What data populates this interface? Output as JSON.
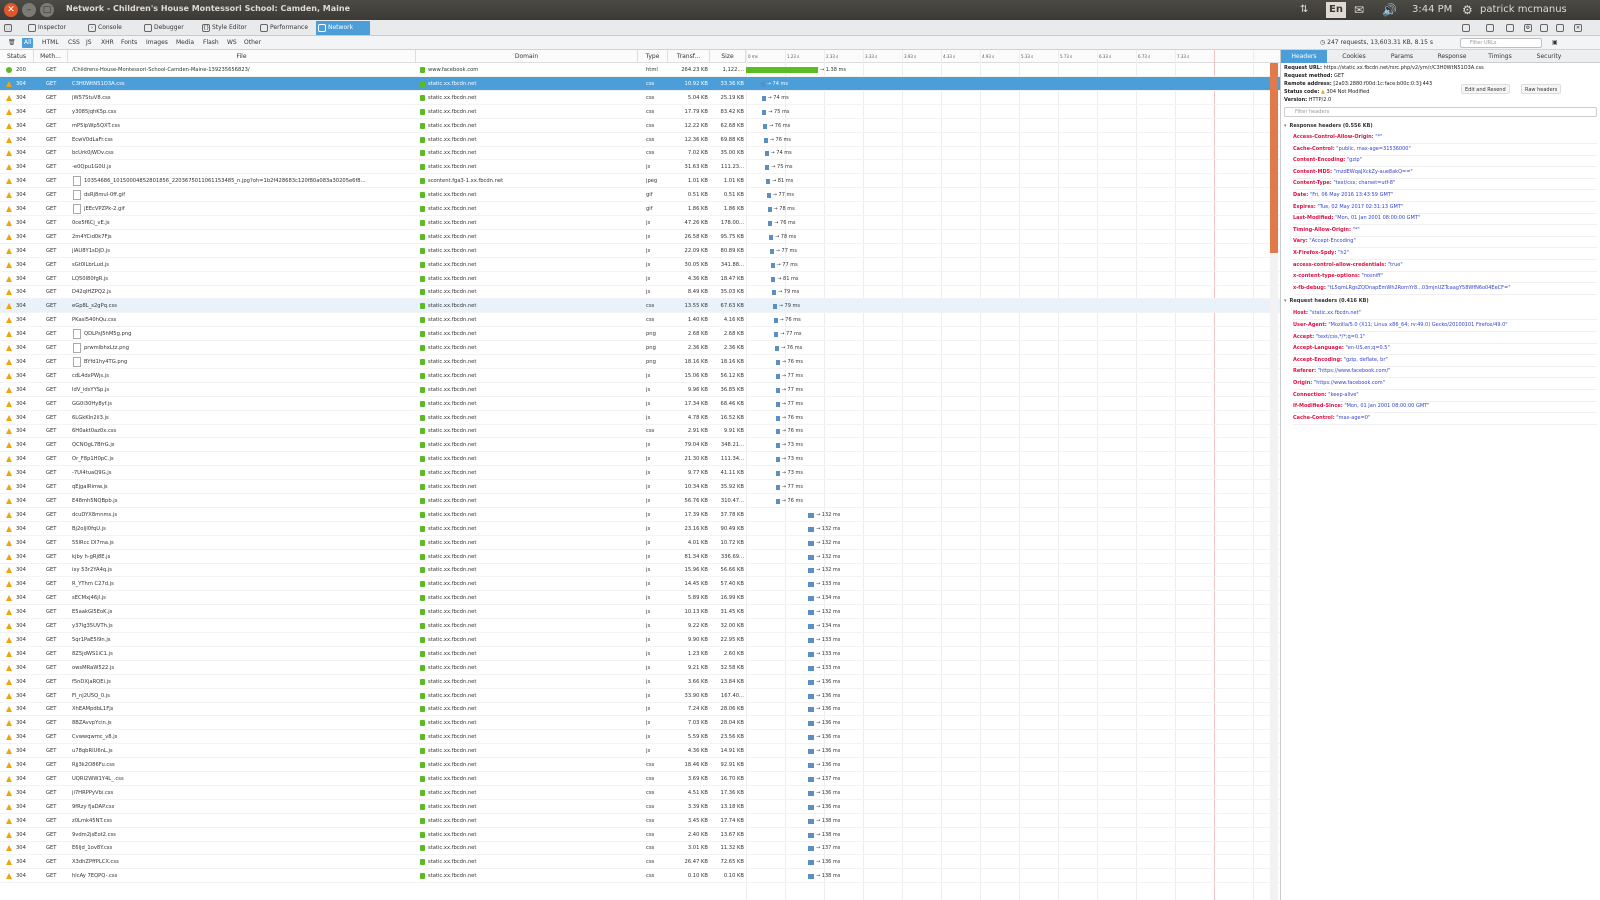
{
  "window": {
    "title": "Network - Children's House Montessori School: Camden, Maine"
  },
  "tray": {
    "lang": "En",
    "time": "3:44 PM",
    "user": "patrick mcmanus"
  },
  "toolbar": {
    "tools": [
      "Inspector",
      "Console",
      "Debugger",
      "Style Editor",
      "Performance",
      "Network"
    ],
    "active": "Network"
  },
  "filters": {
    "types": [
      "All",
      "HTML",
      "CSS",
      "JS",
      "XHR",
      "Fonts",
      "Images",
      "Media",
      "Flash",
      "WS",
      "Other"
    ],
    "active": "All"
  },
  "summary": "247 requests, 13,603.31 KB, 8.15 s",
  "filter_url_placeholder": "Filter URLs",
  "columns": {
    "status": "Status",
    "method": "Meth...",
    "file": "File",
    "domain": "Domain",
    "type": "Type",
    "transferred": "Transf...",
    "size": "Size"
  },
  "timeline_ticks": [
    "0 ms",
    "1.23 s",
    "2.33 s",
    "3.33 s",
    "3.93 s",
    "4.33 s",
    "4.93 s",
    "5.33 s",
    "5.73 s",
    "6.33 s",
    "6.73 s",
    "7.33 s"
  ],
  "requests": [
    {
      "status": "200",
      "method": "GET",
      "file": "/Childrens-House-Montessori-School-Camden-Maine-139235656823/",
      "domain": "www.facebook.com",
      "type": "html",
      "transferred": "264.23 KB",
      "size": "1,122....",
      "timing": "→ 1.38 ms"
    },
    {
      "status": "304",
      "method": "GET",
      "file": "C3H0WtN51O3A.css",
      "domain": "static.xx.fbcdn.net",
      "type": "css",
      "transferred": "10.92 KB",
      "size": "33.36 KB",
      "timing": "→ 74 ms"
    },
    {
      "status": "304",
      "method": "GET",
      "file": "jW57StuV8.css",
      "domain": "static.xx.fbcdn.net",
      "type": "css",
      "transferred": "5.04 KB",
      "size": "25.19 KB",
      "timing": "→ 74 ms"
    },
    {
      "status": "304",
      "method": "GET",
      "file": "y3085jqhK5p.css",
      "domain": "static.xx.fbcdn.net",
      "type": "css",
      "transferred": "17.79 KB",
      "size": "83.42 KB",
      "timing": "→ 75 ms"
    },
    {
      "status": "304",
      "method": "GET",
      "file": "mP5lpWp5QXT.css",
      "domain": "static.xx.fbcdn.net",
      "type": "css",
      "transferred": "12.22 KB",
      "size": "62.68 KB",
      "timing": "→ 76 ms"
    },
    {
      "status": "304",
      "method": "GET",
      "file": "EcwV0dLaFr.css",
      "domain": "static.xx.fbcdn.net",
      "type": "css",
      "transferred": "12.36 KB",
      "size": "69.88 KB",
      "timing": "→ 76 ms"
    },
    {
      "status": "304",
      "method": "GET",
      "file": "bcUrk0jWDv.css",
      "domain": "static.xx.fbcdn.net",
      "type": "css",
      "transferred": "7.02 KB",
      "size": "35.00 KB",
      "timing": "→ 74 ms"
    },
    {
      "status": "304",
      "method": "GET",
      "file": "-e0Qpu1G0U.js",
      "domain": "static.xx.fbcdn.net",
      "type": "js",
      "transferred": "31.63 KB",
      "size": "111.23...",
      "timing": "→ 75 ms"
    },
    {
      "status": "304",
      "method": "GET",
      "file": "10354686_10150004852801856_2203675011061153485_n.jpg?oh=1b2f428683c120f80a083a30205e6f8...",
      "domain": "scontent.fga3-1.xx.fbcdn.net",
      "type": "jpeg",
      "transferred": "1.01 KB",
      "size": "1.01 KB",
      "timing": "→ 81 ms"
    },
    {
      "status": "304",
      "method": "GET",
      "file": "dsRj8mul-0ff.gif",
      "domain": "static.xx.fbcdn.net",
      "type": "gif",
      "transferred": "0.51 KB",
      "size": "0.51 KB",
      "timing": "→ 77 ms"
    },
    {
      "status": "304",
      "method": "GET",
      "file": "jEEcVPZPk-2.gif",
      "domain": "static.xx.fbcdn.net",
      "type": "gif",
      "transferred": "1.86 KB",
      "size": "1.86 KB",
      "timing": "→ 78 ms"
    },
    {
      "status": "304",
      "method": "GET",
      "file": "0ce5f6Cj_vE.js",
      "domain": "static.xx.fbcdn.net",
      "type": "js",
      "transferred": "47.26 KB",
      "size": "178.00...",
      "timing": "→ 76 ms"
    },
    {
      "status": "304",
      "method": "GET",
      "file": "2m4YCid0k7Fjs",
      "domain": "static.xx.fbcdn.net",
      "type": "js",
      "transferred": "26.58 KB",
      "size": "95.75 KB",
      "timing": "→ 78 ms"
    },
    {
      "status": "304",
      "method": "GET",
      "file": "jlAU8Y1sDjD.js",
      "domain": "static.xx.fbcdn.net",
      "type": "js",
      "transferred": "22.09 KB",
      "size": "80.89 KB",
      "timing": "→ 77 ms"
    },
    {
      "status": "304",
      "method": "GET",
      "file": "sGt0lLbrLud.js",
      "domain": "static.xx.fbcdn.net",
      "type": "js",
      "transferred": "30.05 KB",
      "size": "341.88...",
      "timing": "→ 77 ms"
    },
    {
      "status": "304",
      "method": "GET",
      "file": "LQ50l80fgR.js",
      "domain": "static.xx.fbcdn.net",
      "type": "js",
      "transferred": "4.36 KB",
      "size": "18.47 KB",
      "timing": "→ 81 ms"
    },
    {
      "status": "304",
      "method": "GET",
      "file": "D42qlHZPQ2.js",
      "domain": "static.xx.fbcdn.net",
      "type": "js",
      "transferred": "8.49 KB",
      "size": "35.03 KB",
      "timing": "→ 79 ms"
    },
    {
      "status": "304",
      "method": "GET",
      "file": "eGp8L_s2gPq.css",
      "domain": "static.xx.fbcdn.net",
      "type": "css",
      "transferred": "13.55 KB",
      "size": "67.63 KB",
      "timing": "→ 79 ms"
    },
    {
      "status": "304",
      "method": "GET",
      "file": "PKasl540hQu.css",
      "domain": "static.xx.fbcdn.net",
      "type": "css",
      "transferred": "1.40 KB",
      "size": "4.16 KB",
      "timing": "→ 76 ms"
    },
    {
      "status": "304",
      "method": "GET",
      "file": "QDLPsJ5hM5g.png",
      "domain": "static.xx.fbcdn.net",
      "type": "png",
      "transferred": "2.68 KB",
      "size": "2.68 KB",
      "timing": "→ 77 ms"
    },
    {
      "status": "304",
      "method": "GET",
      "file": "prwmlbhxLtz.png",
      "domain": "static.xx.fbcdn.net",
      "type": "png",
      "transferred": "2.36 KB",
      "size": "2.36 KB",
      "timing": "→ 76 ms"
    },
    {
      "status": "304",
      "method": "GET",
      "file": "BYfd1hy4TG.png",
      "domain": "static.xx.fbcdn.net",
      "type": "png",
      "transferred": "18.16 KB",
      "size": "18.16 KB",
      "timing": "→ 76 ms"
    },
    {
      "status": "304",
      "method": "GET",
      "file": "cdL4dxPWjs.js",
      "domain": "static.xx.fbcdn.net",
      "type": "js",
      "transferred": "15.06 KB",
      "size": "56.12 KB",
      "timing": "→ 77 ms"
    },
    {
      "status": "304",
      "method": "GET",
      "file": "IdV_idsYYSp.js",
      "domain": "static.xx.fbcdn.net",
      "type": "js",
      "transferred": "9.96 KB",
      "size": "36.85 KB",
      "timing": "→ 77 ms"
    },
    {
      "status": "304",
      "method": "GET",
      "file": "GG0i30Hy8yf.js",
      "domain": "static.xx.fbcdn.net",
      "type": "js",
      "transferred": "17.34 KB",
      "size": "68.46 KB",
      "timing": "→ 77 ms"
    },
    {
      "status": "304",
      "method": "GET",
      "file": "6LGkKIn2il3.js",
      "domain": "static.xx.fbcdn.net",
      "type": "js",
      "transferred": "4.78 KB",
      "size": "16.52 KB",
      "timing": "→ 76 ms"
    },
    {
      "status": "304",
      "method": "GET",
      "file": "6H0akt0az0x.css",
      "domain": "static.xx.fbcdn.net",
      "type": "css",
      "transferred": "2.91 KB",
      "size": "9.91 KB",
      "timing": "→ 76 ms"
    },
    {
      "status": "304",
      "method": "GET",
      "file": "QCNOgL7BfrG.js",
      "domain": "static.xx.fbcdn.net",
      "type": "js",
      "transferred": "79.04 KB",
      "size": "348.21...",
      "timing": "→ 73 ms"
    },
    {
      "status": "304",
      "method": "GET",
      "file": "Or_F8p1H0pC.js",
      "domain": "static.xx.fbcdn.net",
      "type": "js",
      "transferred": "21.30 KB",
      "size": "111.34...",
      "timing": "→ 73 ms"
    },
    {
      "status": "304",
      "method": "GET",
      "file": "-7Ul4tuaQ9G.js",
      "domain": "static.xx.fbcdn.net",
      "type": "js",
      "transferred": "9.77 KB",
      "size": "41.11 KB",
      "timing": "→ 73 ms"
    },
    {
      "status": "304",
      "method": "GET",
      "file": "qEjgalRimw.js",
      "domain": "static.xx.fbcdn.net",
      "type": "js",
      "transferred": "10.34 KB",
      "size": "35.92 KB",
      "timing": "→ 77 ms"
    },
    {
      "status": "304",
      "method": "GET",
      "file": "E48mh5NQBpb.js",
      "domain": "static.xx.fbcdn.net",
      "type": "js",
      "transferred": "56.76 KB",
      "size": "310.47...",
      "timing": "→ 76 ms"
    },
    {
      "status": "304",
      "method": "GET",
      "file": "dcuDYX8mnms.js",
      "domain": "static.xx.fbcdn.net",
      "type": "js",
      "transferred": "17.39 KB",
      "size": "37.78 KB",
      "timing": "→ 132 ms"
    },
    {
      "status": "304",
      "method": "GET",
      "file": "Bj2oljl0fqU.js",
      "domain": "static.xx.fbcdn.net",
      "type": "js",
      "transferred": "23.16 KB",
      "size": "90.49 KB",
      "timing": "→ 132 ms"
    },
    {
      "status": "304",
      "method": "GET",
      "file": "55lRcc Dl7ma.js",
      "domain": "static.xx.fbcdn.net",
      "type": "js",
      "transferred": "4.01 KB",
      "size": "10.72 KB",
      "timing": "→ 132 ms"
    },
    {
      "status": "304",
      "method": "GET",
      "file": "kjby h-gRj8E.js",
      "domain": "static.xx.fbcdn.net",
      "type": "js",
      "transferred": "81.34 KB",
      "size": "336.69...",
      "timing": "→ 132 ms"
    },
    {
      "status": "304",
      "method": "GET",
      "file": "ixy 53r2YA4q.js",
      "domain": "static.xx.fbcdn.net",
      "type": "js",
      "transferred": "15.96 KB",
      "size": "56.66 KB",
      "timing": "→ 132 ms"
    },
    {
      "status": "304",
      "method": "GET",
      "file": "R_YThm C27d.js",
      "domain": "static.xx.fbcdn.net",
      "type": "js",
      "transferred": "14.45 KB",
      "size": "57.40 KB",
      "timing": "→ 133 ms"
    },
    {
      "status": "304",
      "method": "GET",
      "file": "sECMxj46jl.js",
      "domain": "static.xx.fbcdn.net",
      "type": "js",
      "transferred": "5.89 KB",
      "size": "16.99 KB",
      "timing": "→ 134 ms"
    },
    {
      "status": "304",
      "method": "GET",
      "file": "E5aakGl5EoK.js",
      "domain": "static.xx.fbcdn.net",
      "type": "js",
      "transferred": "10.13 KB",
      "size": "31.45 KB",
      "timing": "→ 132 ms"
    },
    {
      "status": "304",
      "method": "GET",
      "file": "y37Ig35UVTh.js",
      "domain": "static.xx.fbcdn.net",
      "type": "js",
      "transferred": "9.22 KB",
      "size": "32.00 KB",
      "timing": "→ 134 ms"
    },
    {
      "status": "304",
      "method": "GET",
      "file": "5qr1PaE5l9n.js",
      "domain": "static.xx.fbcdn.net",
      "type": "js",
      "transferred": "9.90 KB",
      "size": "22.95 KB",
      "timing": "→ 133 ms"
    },
    {
      "status": "304",
      "method": "GET",
      "file": "8Z5jdWS1iC1.js",
      "domain": "static.xx.fbcdn.net",
      "type": "js",
      "transferred": "1.23 KB",
      "size": "2.60 KB",
      "timing": "→ 133 ms"
    },
    {
      "status": "304",
      "method": "GET",
      "file": "owsMRaW522.js",
      "domain": "static.xx.fbcdn.net",
      "type": "js",
      "transferred": "9.21 KB",
      "size": "32.58 KB",
      "timing": "→ 133 ms"
    },
    {
      "status": "304",
      "method": "GET",
      "file": "f5nDXjaRQEi.js",
      "domain": "static.xx.fbcdn.net",
      "type": "js",
      "transferred": "3.66 KB",
      "size": "13.84 KB",
      "timing": "→ 136 ms"
    },
    {
      "status": "304",
      "method": "GET",
      "file": "Fl_nj2U5Q_0.js",
      "domain": "static.xx.fbcdn.net",
      "type": "js",
      "transferred": "33.90 KB",
      "size": "167.40...",
      "timing": "→ 136 ms"
    },
    {
      "status": "304",
      "method": "GET",
      "file": "XhEAMpdbL1Fjs",
      "domain": "static.xx.fbcdn.net",
      "type": "js",
      "transferred": "7.24 KB",
      "size": "28.06 KB",
      "timing": "→ 136 ms"
    },
    {
      "status": "304",
      "method": "GET",
      "file": "8BZAvvpYcin.js",
      "domain": "static.xx.fbcdn.net",
      "type": "js",
      "transferred": "7.03 KB",
      "size": "28.04 KB",
      "timing": "→ 136 ms"
    },
    {
      "status": "304",
      "method": "GET",
      "file": "Cvwwqwmc_v8.js",
      "domain": "static.xx.fbcdn.net",
      "type": "js",
      "transferred": "5.59 KB",
      "size": "23.56 KB",
      "timing": "→ 136 ms"
    },
    {
      "status": "304",
      "method": "GET",
      "file": "u78qbRlU6nL.js",
      "domain": "static.xx.fbcdn.net",
      "type": "js",
      "transferred": "4.36 KB",
      "size": "14.91 KB",
      "timing": "→ 136 ms"
    },
    {
      "status": "304",
      "method": "GET",
      "file": "Rjj3k2O86Fu.css",
      "domain": "static.xx.fbcdn.net",
      "type": "css",
      "transferred": "18.46 KB",
      "size": "92.91 KB",
      "timing": "→ 136 ms"
    },
    {
      "status": "304",
      "method": "GET",
      "file": "UQRl2WW1Y4L_.css",
      "domain": "static.xx.fbcdn.net",
      "type": "css",
      "transferred": "3.69 KB",
      "size": "16.70 KB",
      "timing": "→ 137 ms"
    },
    {
      "status": "304",
      "method": "GET",
      "file": "ji7HRPPyVbi.css",
      "domain": "static.xx.fbcdn.net",
      "type": "css",
      "transferred": "4.51 KB",
      "size": "17.36 KB",
      "timing": "→ 136 ms"
    },
    {
      "status": "304",
      "method": "GET",
      "file": "9fRzy fjaDAP.css",
      "domain": "static.xx.fbcdn.net",
      "type": "css",
      "transferred": "3.39 KB",
      "size": "13.18 KB",
      "timing": "→ 136 ms"
    },
    {
      "status": "304",
      "method": "GET",
      "file": "z0Lmk45NT.css",
      "domain": "static.xx.fbcdn.net",
      "type": "css",
      "transferred": "3.45 KB",
      "size": "17.74 KB",
      "timing": "→ 138 ms"
    },
    {
      "status": "304",
      "method": "GET",
      "file": "9vdm2jsEot2.css",
      "domain": "static.xx.fbcdn.net",
      "type": "css",
      "transferred": "2.40 KB",
      "size": "13.67 KB",
      "timing": "→ 138 ms"
    },
    {
      "status": "304",
      "method": "GET",
      "file": "E6ljd_1ov8Y.css",
      "domain": "static.xx.fbcdn.net",
      "type": "css",
      "transferred": "3.01 KB",
      "size": "11.32 KB",
      "timing": "→ 137 ms"
    },
    {
      "status": "304",
      "method": "GET",
      "file": "X3dhZPffPLCX.css",
      "domain": "static.xx.fbcdn.net",
      "type": "css",
      "transferred": "26.47 KB",
      "size": "72.65 KB",
      "timing": "→ 136 ms"
    },
    {
      "status": "304",
      "method": "GET",
      "file": "hlcAy 7EQPQ-.css",
      "domain": "static.xx.fbcdn.net",
      "type": "css",
      "transferred": "0.10 KB",
      "size": "0.10 KB",
      "timing": "→ 138 ms"
    }
  ],
  "panel": {
    "tabs": [
      "Headers",
      "Cookies",
      "Params",
      "Response",
      "Timings",
      "Security"
    ],
    "active_tab": "Headers",
    "summary": {
      "request_url_label": "Request URL:",
      "request_url": "https://static.xx.fbcdn.net/rsrc.php/v2/ym/r/C3H0WtN51O3A.css",
      "request_method_label": "Request method:",
      "request_method": "GET",
      "remote_address_label": "Remote address:",
      "remote_address": "[2a03:2880:f00d:1c:face:b00c:0:3]:443",
      "status_code_label": "Status code:",
      "status_code": "304 Not Modified",
      "version_label": "Version:",
      "version": "HTTP/2.0"
    },
    "edit_resend": "Edit and Resend",
    "raw_headers": "Raw headers",
    "filter_headers_placeholder": "Filter headers",
    "response_section": "Response headers (0.556 KB)",
    "response_headers": [
      {
        "key": "Access-Control-Allow-Origin:",
        "value": "\"*\""
      },
      {
        "key": "Cache-Control:",
        "value": "\"public, max-age=31536000\""
      },
      {
        "key": "Content-Encoding:",
        "value": "\"gzip\""
      },
      {
        "key": "Content-MD5:",
        "value": "\"mzdEWqaJXckZy-aue8akQ==\""
      },
      {
        "key": "Content-Type:",
        "value": "\"text/css; charset=utf-8\""
      },
      {
        "key": "Date:",
        "value": "\"Fri, 06 May 2016 13:43:59 GMT\""
      },
      {
        "key": "Expires:",
        "value": "\"Tue, 02 May 2017 02:31:13 GMT\""
      },
      {
        "key": "Last-Modified:",
        "value": "\"Mon, 01 Jan 2001 08:00:00 GMT\""
      },
      {
        "key": "Timing-Allow-Origin:",
        "value": "\"*\""
      },
      {
        "key": "Vary:",
        "value": "\"Accept-Encoding\""
      },
      {
        "key": "X-Firefox-Spdy:",
        "value": "\"h2\""
      },
      {
        "key": "access-control-allow-credentials:",
        "value": "\"true\""
      },
      {
        "key": "x-content-type-options:",
        "value": "\"nosniff\""
      },
      {
        "key": "x-fb-debug:",
        "value": "\"tL5qmLRgsZQDnapEmWh2RomYr8...03mjnUZTcaagY58WfN6o04EeCF=\""
      }
    ],
    "request_section": "Request headers (0.416 KB)",
    "request_headers": [
      {
        "key": "Host:",
        "value": "\"static.xx.fbcdn.net\""
      },
      {
        "key": "User-Agent:",
        "value": "\"Mozilla/5.0 (X11; Linux x86_64; rv:49.0) Gecko/20100101 Firefox/49.0\""
      },
      {
        "key": "Accept:",
        "value": "\"text/css,*/*;q=0.1\""
      },
      {
        "key": "Accept-Language:",
        "value": "\"en-US,en;q=0.5\""
      },
      {
        "key": "Accept-Encoding:",
        "value": "\"gzip, deflate, br\""
      },
      {
        "key": "Referer:",
        "value": "\"https://www.facebook.com/\""
      },
      {
        "key": "Origin:",
        "value": "\"https://www.facebook.com\""
      },
      {
        "key": "Connection:",
        "value": "\"keep-alive\""
      },
      {
        "key": "If-Modified-Since:",
        "value": "\"Mon, 01 Jan 2001 08:00:00 GMT\""
      },
      {
        "key": "Cache-Control:",
        "value": "\"max-age=0\""
      }
    ]
  },
  "colors": {
    "accent": "#4c9ed9",
    "warning": "#f0a30a",
    "ok": "#5bbb22",
    "header_key": "#dd1144",
    "header_value": "#3344cc"
  }
}
